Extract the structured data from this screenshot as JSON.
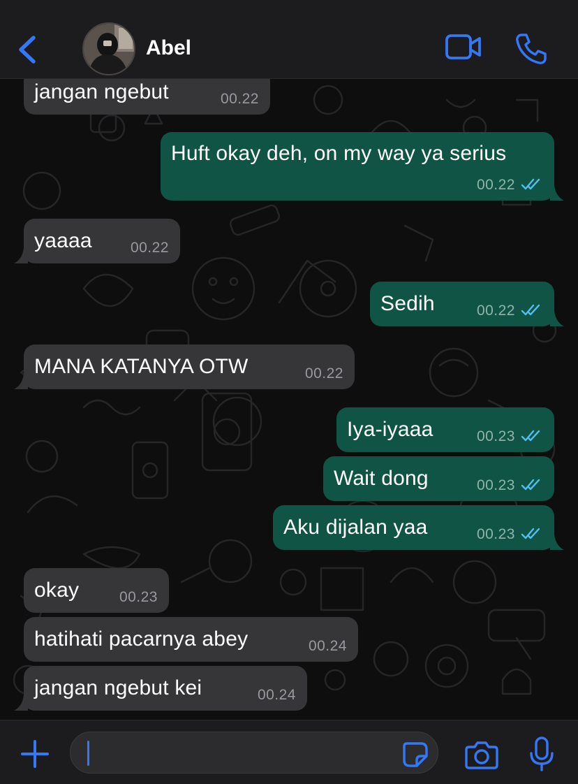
{
  "header": {
    "contact_name": "Abel",
    "back_icon": "chevron-left-icon",
    "video_icon": "video-camera-icon",
    "call_icon": "phone-icon"
  },
  "messages": [
    {
      "dir": "in",
      "text": "jangan ngebut",
      "time": "00.22"
    },
    {
      "dir": "out",
      "text": "Huft okay deh, on my way ya serius",
      "time": "00.22",
      "status": "read"
    },
    {
      "dir": "in",
      "text": "yaaaa",
      "time": "00.22"
    },
    {
      "dir": "out",
      "text": "Sedih",
      "time": "00.22",
      "status": "read"
    },
    {
      "dir": "in",
      "text": "MANA KATANYA OTW",
      "time": "00.22"
    },
    {
      "dir": "out",
      "text": "Iya-iyaaa",
      "time": "00.23",
      "status": "read"
    },
    {
      "dir": "out",
      "text": "Wait dong",
      "time": "00.23",
      "status": "read"
    },
    {
      "dir": "out",
      "text": "Aku dijalan yaa",
      "time": "00.23",
      "status": "read"
    },
    {
      "dir": "in",
      "text": "okay",
      "time": "00.23"
    },
    {
      "dir": "in",
      "text": "hatihati pacarnya abey",
      "time": "00.24"
    },
    {
      "dir": "in",
      "text": "jangan ngebut kei",
      "time": "00.24"
    }
  ],
  "input": {
    "placeholder": "",
    "value": ""
  },
  "colors": {
    "accent": "#3478f6",
    "incoming_bubble": "#363638",
    "outgoing_bubble": "#0f5444",
    "read_ticks": "#53bdeb"
  }
}
